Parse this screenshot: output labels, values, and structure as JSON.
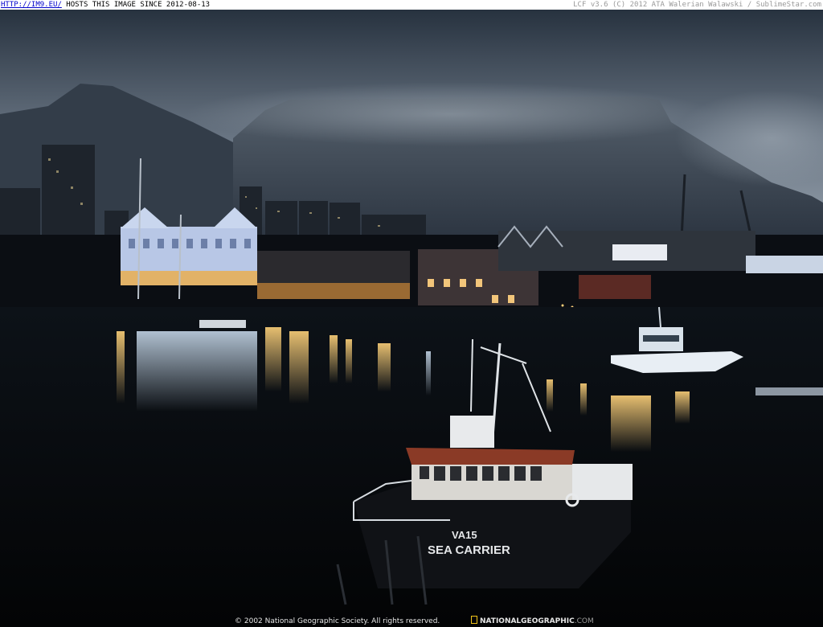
{
  "header": {
    "site_link": "HTTP://IM9.EU/",
    "hosts_text": "HOSTS THIS IMAGE SINCE 2012-08-13",
    "credit_text": "LCF v3.6 (C) 2012 ATA Walerian Walawski / SublimeStar.com"
  },
  "photo": {
    "boat_registration": "VA15",
    "boat_name": "SEA CARRIER"
  },
  "footer": {
    "copyright": "© 2002 National Geographic Society. All rights reserved.",
    "brand": "NATIONALGEOGRAPHIC",
    "brand_domain": ".COM"
  },
  "colors": {
    "sky_top": "#2a3646",
    "sky_bottom": "#8a96a4",
    "mountain": "#3e4a58",
    "water": "#07090d",
    "light_yellow": "#ffcc66",
    "hull": "#101014",
    "cabin_roof": "#8a3a26",
    "ng_yellow": "#f0c419"
  }
}
